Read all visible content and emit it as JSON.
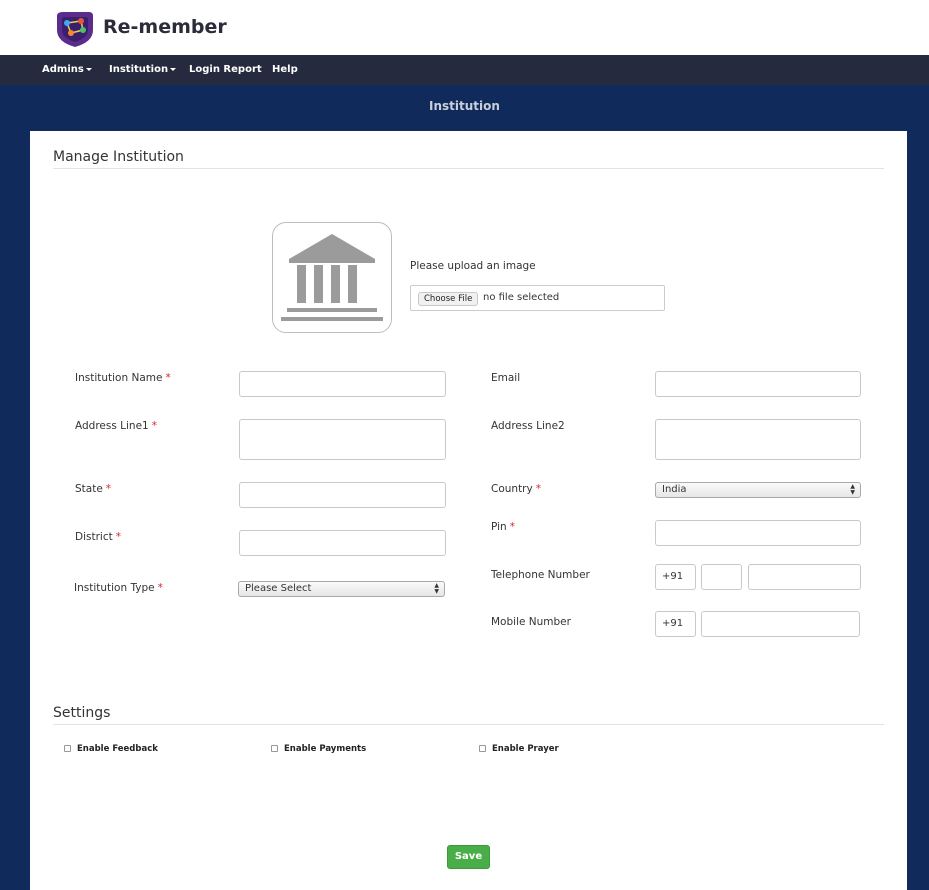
{
  "app": {
    "brand": "Re-member",
    "logo_icon": "re-member-logo-icon"
  },
  "nav": {
    "items": [
      {
        "label": "Admins",
        "has_caret": true
      },
      {
        "label": "Institution",
        "has_caret": true
      },
      {
        "label": "Login Report",
        "has_caret": false
      },
      {
        "label": "Help",
        "has_caret": false
      }
    ]
  },
  "page": {
    "title": "Institution"
  },
  "manage": {
    "section_title": "Manage Institution",
    "image_icon": "institution-building-icon",
    "upload_label": "Please upload an image",
    "choose_file_label": "Choose File",
    "file_status": "no file selected"
  },
  "form": {
    "institution_name_label": "Institution Name",
    "address_line1_label": "Address Line1",
    "state_label": "State",
    "district_label": "District",
    "institution_type_label": "Institution Type",
    "institution_type_value": "Please Select",
    "email_label": "Email",
    "address_line2_label": "Address Line2",
    "country_label": "Country",
    "country_value": "India",
    "pin_label": "Pin",
    "telephone_label": "Telephone Number",
    "telephone_prefix": "+91",
    "mobile_label": "Mobile Number",
    "mobile_prefix": "+91",
    "required_mark": "*"
  },
  "settings": {
    "section_title": "Settings",
    "options": [
      {
        "label": "Enable Feedback",
        "checked": false
      },
      {
        "label": "Enable Payments",
        "checked": false
      },
      {
        "label": "Enable Prayer",
        "checked": false
      }
    ]
  },
  "actions": {
    "save_label": "Save",
    "save_color": "#4aae48"
  },
  "colors": {
    "navbar": "#262a3e",
    "page_background": "#102a5b",
    "required": "#d9232d"
  }
}
